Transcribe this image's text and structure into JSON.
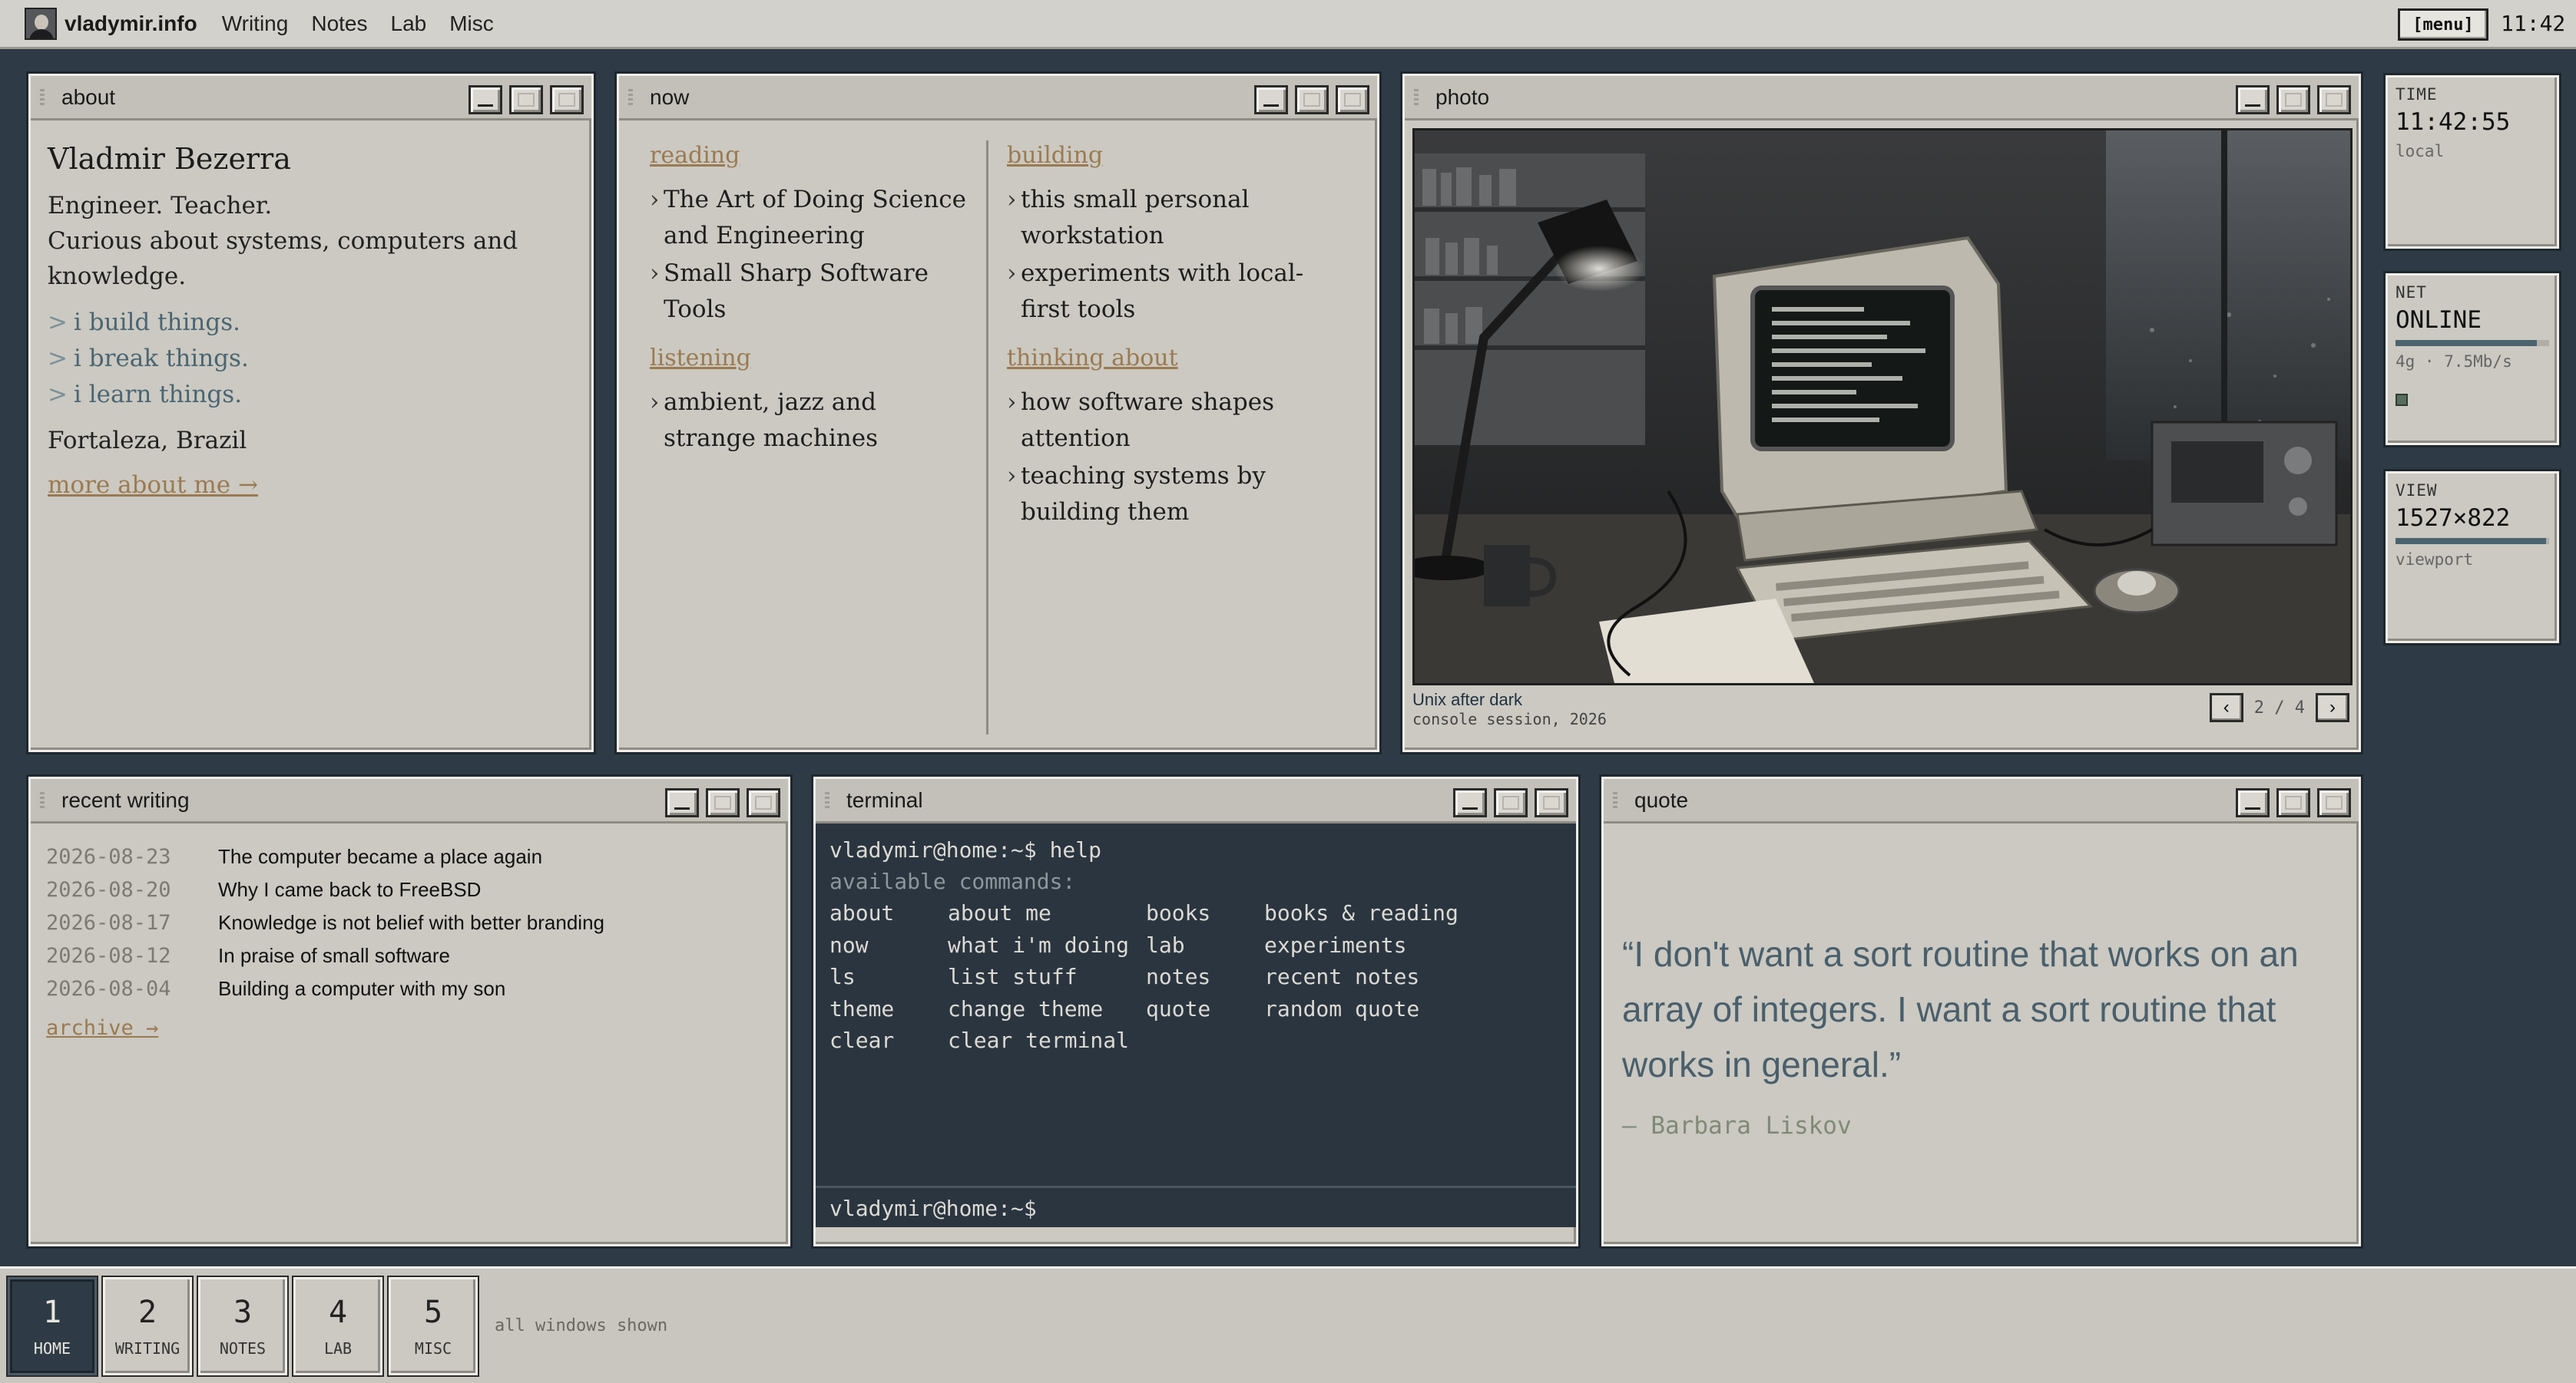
{
  "topbar": {
    "brand": "vladymir.info",
    "nav": [
      "Writing",
      "Notes",
      "Lab",
      "Misc"
    ],
    "menu_label": "[menu]",
    "clock": "11:42"
  },
  "about": {
    "title": "about",
    "name": "Vladmir Bezerra",
    "line1": "Engineer. Teacher.",
    "line2": "Curious about systems, computers and knowledge.",
    "bullets": [
      "i build things.",
      "i break things.",
      "i learn things."
    ],
    "bullet_marker": ">",
    "location": "Fortaleza, Brazil",
    "more_link": "more about me →"
  },
  "now": {
    "title": "now",
    "reading_head": "reading",
    "reading": [
      "The Art of Doing Science and Engineering",
      "Small Sharp Software Tools"
    ],
    "listening_head": "listening",
    "listening": [
      "ambient, jazz and strange machines"
    ],
    "building_head": "building",
    "building": [
      "this small personal workstation",
      "experiments with local-first tools"
    ],
    "thinking_head": "thinking about",
    "thinking": [
      "how software shapes attention",
      "teaching systems by building them"
    ]
  },
  "photo": {
    "title": "photo",
    "caption_title": "Unix after dark",
    "caption_sub": "console session, 2026",
    "prev": "‹",
    "next": "›",
    "current": "2",
    "sep": "/",
    "total": "4"
  },
  "status": {
    "time": {
      "label": "TIME",
      "value": "11:42:55",
      "sub": "local"
    },
    "net": {
      "label": "NET",
      "value": "ONLINE",
      "sub": "4g · 7.5Mb/s",
      "level": 0.92
    },
    "view": {
      "label": "VIEW",
      "value": "1527×822",
      "sub": "viewport",
      "level": 0.98
    }
  },
  "writing": {
    "title": "recent writing",
    "posts": [
      {
        "date": "2026-08-23",
        "title": "The computer became a place again"
      },
      {
        "date": "2026-08-20",
        "title": "Why I came back to FreeBSD"
      },
      {
        "date": "2026-08-17",
        "title": "Knowledge is not belief with better branding"
      },
      {
        "date": "2026-08-12",
        "title": "In praise of small software"
      },
      {
        "date": "2026-08-04",
        "title": "Building a computer with my son"
      }
    ],
    "archive": "archive →"
  },
  "terminal": {
    "title": "terminal",
    "cmd_line": "vladymir@home:~$ help",
    "avail": "available commands:",
    "rows": [
      [
        "about",
        "about me",
        "books",
        "books & reading"
      ],
      [
        "now",
        "what i'm doing",
        "lab",
        "experiments"
      ],
      [
        "ls",
        "list stuff",
        "notes",
        "recent notes"
      ],
      [
        "theme",
        "change theme",
        "quote",
        "random quote"
      ],
      [
        "clear",
        "clear terminal",
        "",
        ""
      ]
    ],
    "prompt": "vladymir@home:~$"
  },
  "quote": {
    "title": "quote",
    "text": "“I don't want a sort routine that works on an array of integers. I want a sort routine that works in general.”",
    "author": "— Barbara Liskov"
  },
  "taskbar": {
    "workspaces": [
      {
        "num": "1",
        "label": "HOME"
      },
      {
        "num": "2",
        "label": "WRITING"
      },
      {
        "num": "3",
        "label": "NOTES"
      },
      {
        "num": "4",
        "label": "LAB"
      },
      {
        "num": "5",
        "label": "MISC"
      }
    ],
    "status": "all windows shown"
  }
}
